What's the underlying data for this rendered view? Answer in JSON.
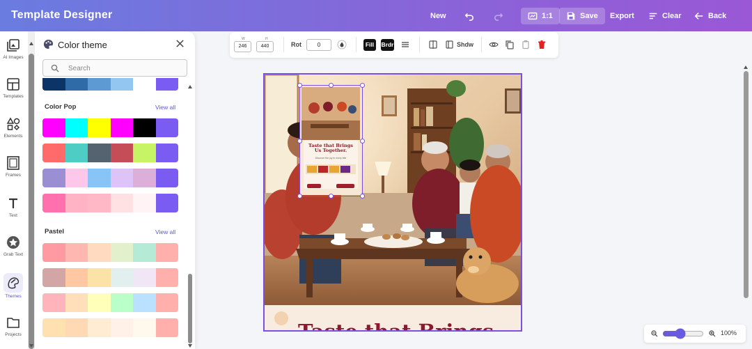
{
  "header": {
    "title": "Template Designer",
    "new_label": "New",
    "ratio_label": "1:1",
    "save_label": "Save",
    "export_label": "Export",
    "clear_label": "Clear",
    "back_label": "Back"
  },
  "rail": {
    "items": [
      {
        "label": "AI Images",
        "icon": "ai-images-icon"
      },
      {
        "label": "Templates",
        "icon": "templates-icon"
      },
      {
        "label": "Elements",
        "icon": "elements-icon"
      },
      {
        "label": "Frames",
        "icon": "frames-icon"
      },
      {
        "label": "Text",
        "icon": "text-icon"
      },
      {
        "label": "Grab Text",
        "icon": "grab-text-icon"
      },
      {
        "label": "Themes",
        "icon": "themes-icon"
      },
      {
        "label": "Projects",
        "icon": "projects-icon"
      }
    ]
  },
  "panel": {
    "title": "Color theme",
    "search_placeholder": "Search",
    "partial_palette": [
      "#0d3466",
      "#2f6ba6",
      "#5d9ad3",
      "#93c7f1",
      "#ffffff",
      "#7a5cf2"
    ],
    "sections": [
      {
        "name": "Color Pop",
        "view_all": "View all",
        "palettes": [
          [
            "#ff00ff",
            "#00ffff",
            "#ffff00",
            "#ff00ff",
            "#000000",
            "#7a5cf2"
          ],
          [
            "#ff6b6b",
            "#4ecdc4",
            "#556270",
            "#c44d58",
            "#c7f464",
            "#7a5cf2"
          ],
          [
            "#9b8fd3",
            "#fdc7ea",
            "#89c4f7",
            "#ddc3f7",
            "#dcaed8",
            "#7a5cf2"
          ],
          [
            "#ff70ae",
            "#ffb3c4",
            "#ffb8c6",
            "#ffe1e3",
            "#fff3f6",
            "#7a5cf2"
          ]
        ]
      },
      {
        "name": "Pastel",
        "view_all": "View all",
        "palettes": [
          [
            "#ff9aa2",
            "#ffb7b2",
            "#ffdac1",
            "#e2f0cb",
            "#b5ead7",
            "#ffb0ac"
          ],
          [
            "#d4a5a5",
            "#ffc8a2",
            "#fbe2a7",
            "#e1f0ef",
            "#f0e6f6",
            "#ffb0ac"
          ],
          [
            "#ffb3ba",
            "#ffdfba",
            "#ffffba",
            "#baffc9",
            "#bae1ff",
            "#ffb0ac"
          ],
          [
            "#ffe0b0",
            "#ffd9b3",
            "#ffecd2",
            "#fff0e8",
            "#fff8ec",
            "#ffb0ac"
          ]
        ]
      }
    ]
  },
  "toolbar": {
    "w_label": "W",
    "w_value": "246",
    "h_label": "H",
    "h_value": "440",
    "rot_label": "Rot",
    "rot_value": "0",
    "fill_label": "Fill",
    "border_label": "Brdr",
    "shadow_label": "Shdw"
  },
  "canvas": {
    "inner_headline": "Taste that Brings Us Together.",
    "inner_sub": "Discover the joy in every bite",
    "bottom_headline": "Taste that Brings"
  },
  "zoom": {
    "value_label": "100%",
    "level": 40
  },
  "colors": {
    "accent": "#7b4fe0",
    "header_start": "#6a7ce0",
    "header_end": "#9a58d6"
  }
}
